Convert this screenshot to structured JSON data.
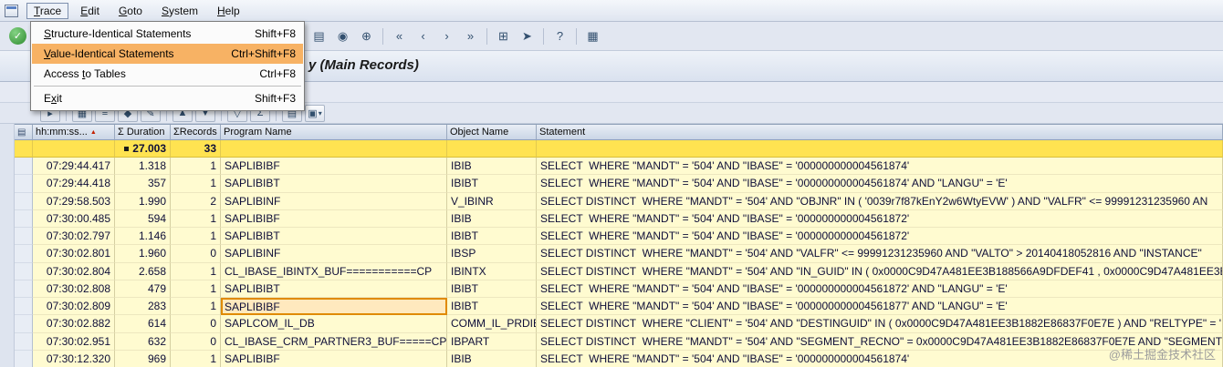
{
  "title": {
    "text": "y (Main Records)"
  },
  "watermark": {
    "text": "@稀土掘金技术社区"
  },
  "colors": {
    "menu_highlight": "#F7B264",
    "total_row_bg": "#FFE351",
    "row_bg": "#FFFBD0",
    "header_bg": "#C8D4E4",
    "selected_cell_border": "#E08A00"
  },
  "menu_bar": {
    "items": [
      {
        "label": "Trace",
        "accel": 0,
        "active": true
      },
      {
        "label": "Edit",
        "accel": 0
      },
      {
        "label": "Goto",
        "accel": 0
      },
      {
        "label": "System",
        "accel": 0
      },
      {
        "label": "Help",
        "accel": 0
      }
    ]
  },
  "trace_menu": {
    "items": [
      {
        "label": "Structure-Identical Statements",
        "accel": 0,
        "shortcut": "Shift+F8"
      },
      {
        "label": "Value-Identical Statements",
        "accel": 0,
        "shortcut": "Ctrl+Shift+F8",
        "highlighted": true
      },
      {
        "label": "Access to Tables",
        "accel": 7,
        "shortcut": "Ctrl+F8"
      },
      {
        "label": "Exit",
        "accel": 1,
        "shortcut": "Shift+F3",
        "separator_before": true
      }
    ]
  },
  "standard_toolbar": {
    "enter_glyph": "✓",
    "icons": [
      {
        "name": "print-icon",
        "glyph": "▤"
      },
      {
        "name": "find-icon",
        "glyph": "◉"
      },
      {
        "name": "find-next-icon",
        "glyph": "⊕"
      },
      {
        "sep": true
      },
      {
        "name": "first-page-icon",
        "glyph": "«"
      },
      {
        "name": "previous-page-icon",
        "glyph": "‹"
      },
      {
        "name": "next-page-icon",
        "glyph": "›"
      },
      {
        "name": "last-page-icon",
        "glyph": "»"
      },
      {
        "sep": true
      },
      {
        "name": "new-session-icon",
        "glyph": "⊞"
      },
      {
        "name": "create-shortcut-icon",
        "glyph": "➤"
      },
      {
        "sep": true
      },
      {
        "name": "help-icon",
        "glyph": "?"
      },
      {
        "sep": true
      },
      {
        "name": "customize-layout-icon",
        "glyph": "▦"
      }
    ]
  },
  "app_toolbar": {
    "caret": "▾",
    "icons": [
      {
        "name": "choose-details-icon",
        "glyph": "▸"
      },
      {
        "sep": true
      },
      {
        "name": "display-object-icon",
        "glyph": "▦"
      },
      {
        "name": "ddic-info-icon",
        "glyph": "≡"
      },
      {
        "name": "explain-sql-icon",
        "glyph": "◆"
      },
      {
        "name": "abap-display-icon",
        "glyph": "✎"
      },
      {
        "sep": true
      },
      {
        "name": "sort-ascending-icon",
        "glyph": "▲"
      },
      {
        "name": "sort-descending-icon",
        "glyph": "▼"
      },
      {
        "sep": true
      },
      {
        "name": "filter-icon",
        "glyph": "▽"
      },
      {
        "name": "summarize-icon",
        "glyph": "Σ"
      },
      {
        "sep": true
      },
      {
        "name": "print-list-icon",
        "glyph": "▤"
      },
      {
        "name": "layout-icon",
        "glyph": "▣",
        "caret": true
      }
    ]
  },
  "grid": {
    "corner_glyph": "▤",
    "sort_indicator": "▲",
    "columns": [
      {
        "key": "time",
        "label": "hh:mm:ss...",
        "sorted": true
      },
      {
        "key": "duration",
        "label": "Σ Duration"
      },
      {
        "key": "records",
        "label": "ΣRecords"
      },
      {
        "key": "program",
        "label": "Program Name"
      },
      {
        "key": "object",
        "label": "Object Name"
      },
      {
        "key": "statement",
        "label": "Statement"
      }
    ],
    "total": {
      "duration": "27.003",
      "records": "33"
    },
    "rows": [
      {
        "time": "07:29:44.417",
        "duration": "1.318",
        "records": "1",
        "program": "SAPLIBIBF",
        "object": "IBIB",
        "statement": "SELECT  WHERE \"MANDT\" = '504' AND \"IBASE\" = '000000000004561874'"
      },
      {
        "time": "07:29:44.418",
        "duration": "357",
        "records": "1",
        "program": "SAPLIBIBT",
        "object": "IBIBT",
        "statement": "SELECT  WHERE \"MANDT\" = '504' AND \"IBASE\" = '000000000004561874' AND \"LANGU\" = 'E'"
      },
      {
        "time": "07:29:58.503",
        "duration": "1.990",
        "records": "2",
        "program": "SAPLIBINF",
        "object": "V_IBINR",
        "statement": "SELECT DISTINCT  WHERE \"MANDT\" = '504' AND \"OBJNR\" IN ( '0039r7f87kEnY2w6WtyEVW' ) AND \"VALFR\" <= 99991231235960 AN"
      },
      {
        "time": "07:30:00.485",
        "duration": "594",
        "records": "1",
        "program": "SAPLIBIBF",
        "object": "IBIB",
        "statement": "SELECT  WHERE \"MANDT\" = '504' AND \"IBASE\" = '000000000004561872'"
      },
      {
        "time": "07:30:02.797",
        "duration": "1.146",
        "records": "1",
        "program": "SAPLIBIBT",
        "object": "IBIBT",
        "statement": "SELECT  WHERE \"MANDT\" = '504' AND \"IBASE\" = '000000000004561872'"
      },
      {
        "time": "07:30:02.801",
        "duration": "1.960",
        "records": "0",
        "program": "SAPLIBINF",
        "object": "IBSP",
        "statement": "SELECT DISTINCT  WHERE \"MANDT\" = '504' AND \"VALFR\" <= 99991231235960 AND \"VALTO\" > 20140418052816 AND \"INSTANCE\""
      },
      {
        "time": "07:30:02.804",
        "duration": "2.658",
        "records": "1",
        "program": "CL_IBASE_IBINTX_BUF===========CP",
        "object": "IBINTX",
        "statement": "SELECT DISTINCT  WHERE \"MANDT\" = '504' AND \"IN_GUID\" IN ( 0x0000C9D47A481EE3B188566A9DFDEF41 , 0x0000C9D47A481EE3B"
      },
      {
        "time": "07:30:02.808",
        "duration": "479",
        "records": "1",
        "program": "SAPLIBIBT",
        "object": "IBIBT",
        "statement": "SELECT  WHERE \"MANDT\" = '504' AND \"IBASE\" = '000000000004561872' AND \"LANGU\" = 'E'"
      },
      {
        "time": "07:30:02.809",
        "duration": "283",
        "records": "1",
        "program": "SAPLIBIBF",
        "object": "IBIBT",
        "program_selected": true,
        "statement": "SELECT  WHERE \"MANDT\" = '504' AND \"IBASE\" = '000000000004561877' AND \"LANGU\" = 'E'"
      },
      {
        "time": "07:30:02.882",
        "duration": "614",
        "records": "0",
        "program": "SAPLCOM_IL_DB",
        "object": "COMM_IL_PRDIB",
        "statement": "SELECT DISTINCT  WHERE \"CLIENT\" = '504' AND \"DESTINGUID\" IN ( 0x0000C9D47A481EE3B1882E86837F0E7E ) AND \"RELTYPE\" = '"
      },
      {
        "time": "07:30:02.951",
        "duration": "632",
        "records": "0",
        "program": "CL_IBASE_CRM_PARTNER3_BUF=====CP",
        "object": "IBPART",
        "statement": "SELECT DISTINCT  WHERE \"MANDT\" = '504' AND \"SEGMENT_RECNO\" = 0x0000C9D47A481EE3B1882E86837F0E7E AND \"SEGMENT\" ="
      },
      {
        "time": "07:30:12.320",
        "duration": "969",
        "records": "1",
        "program": "SAPLIBIBF",
        "object": "IBIB",
        "statement": "SELECT  WHERE \"MANDT\" = '504' AND \"IBASE\" = '000000000004561874'"
      }
    ]
  }
}
